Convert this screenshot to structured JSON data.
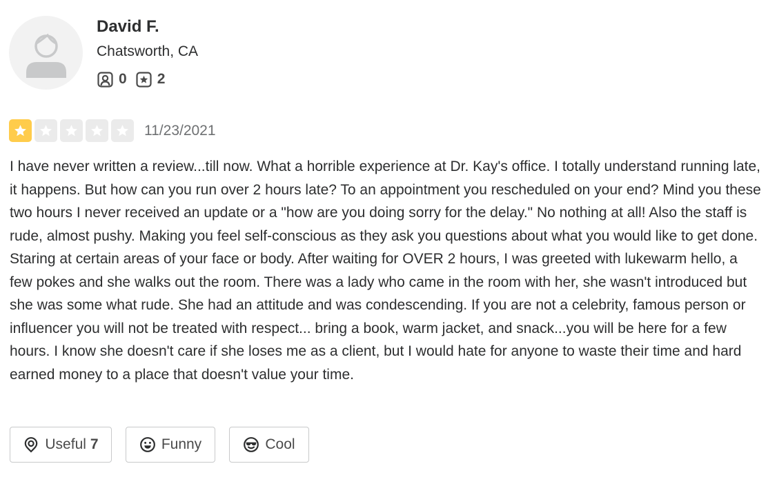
{
  "user": {
    "name": "David F.",
    "location": "Chatsworth, CA",
    "friends_count": "0",
    "reviews_count": "2",
    "avatar_icon": "default-user-avatar-icon",
    "friends_icon": "friends-icon",
    "reviews_icon": "review-star-icon"
  },
  "review": {
    "rating": 1,
    "rating_max": 5,
    "date": "11/23/2021",
    "text": "I have never written a review...till now. What a horrible experience at Dr. Kay's office. I totally understand running late, it happens. But how can you run over 2 hours late? To an appointment you rescheduled on your end? Mind you these two hours I never received an update or a \"how are you doing sorry for the delay.\" No nothing at all! Also the staff is rude, almost pushy. Making you feel self-conscious as they ask you questions about what you would like to get done. Staring at certain areas of your face or body. After waiting for OVER 2 hours, I was greeted with lukewarm hello, a few pokes and she walks out the room. There was a lady who came in the room with her, she wasn't introduced but she was some what rude. She had an attitude and was condescending. If you are not a celebrity, famous person or influencer you will not be treated with respect... bring a book, warm jacket, and snack...you will be here for a few hours. I know she doesn't care if she loses me as a client, but I would hate for anyone to waste their time and hard earned money to a place that doesn't value your time."
  },
  "reactions": {
    "useful_label": "Useful",
    "useful_count": "7",
    "funny_label": "Funny",
    "cool_label": "Cool"
  },
  "colors": {
    "star_filled": "#ffcc4b",
    "star_empty": "#ebebeb",
    "text_primary": "#2d2e2f",
    "text_secondary": "#6e7072",
    "button_border": "#c8c9ca"
  }
}
